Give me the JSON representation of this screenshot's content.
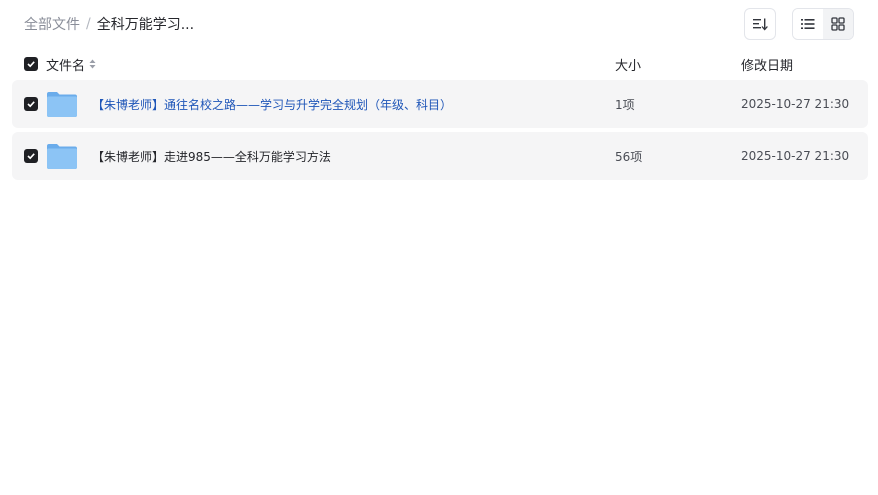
{
  "breadcrumb": {
    "root": "全部文件",
    "separator": "/",
    "current": "全科万能学习..."
  },
  "toolbar": {
    "sort_icon": "sort-lines-icon",
    "list_view_icon": "list-view-icon",
    "grid_view_icon": "grid-view-icon"
  },
  "table": {
    "columns": {
      "name": "文件名",
      "size": "大小",
      "date": "修改日期"
    },
    "rows": [
      {
        "name": "【朱博老师】通往名校之路——学习与升学完全规划（年级、科目）",
        "size": "1项",
        "date": "2025-10-27 21:30"
      },
      {
        "name": "【朱博老师】走进985——全科万能学习方法",
        "size": "56项",
        "date": "2025-10-27 21:30"
      }
    ]
  },
  "colors": {
    "link": "#1f56b8",
    "checkbox": "#1f2024",
    "row_bg": "#f5f5f6",
    "folder": "#7cb8f0"
  }
}
